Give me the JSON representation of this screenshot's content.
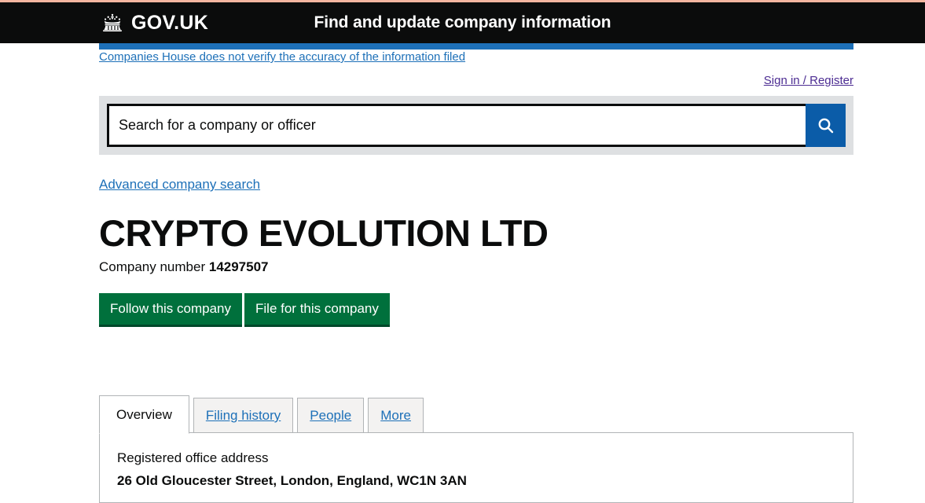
{
  "header": {
    "logo_text": "GOV.UK",
    "crown_icon": "crown-icon",
    "service_name": "Find and update company information"
  },
  "disclaimer": {
    "text": "Companies House does not verify the accuracy of the information filed"
  },
  "account": {
    "signin_label": "Sign in / Register"
  },
  "search": {
    "placeholder": "Search for a company or officer",
    "value": "",
    "button_icon": "search-icon",
    "advanced_label": "Advanced company search"
  },
  "company": {
    "name": "CRYPTO EVOLUTION LTD",
    "number_label": "Company number",
    "number": "14297507"
  },
  "actions": {
    "follow_label": "Follow this company",
    "file_label": "File for this company"
  },
  "tabs": [
    {
      "label": "Overview"
    },
    {
      "label": "Filing history"
    },
    {
      "label": "People"
    },
    {
      "label": "More"
    }
  ],
  "overview": {
    "address_label": "Registered office address",
    "address_value": "26 Old Gloucester Street, London, England, WC1N 3AN"
  },
  "colors": {
    "header_black": "#0b0c0c",
    "top_border": "#f4b6a0",
    "blue_strip": "#1d70b8",
    "link_blue": "#1d70b8",
    "visited_purple": "#4c2c92",
    "search_button_blue": "#0b5ca8",
    "search_bg_grey": "#dee0e2",
    "green": "#00703c",
    "tab_grey": "#f3f2f1",
    "border_grey": "#b1b4b6"
  }
}
